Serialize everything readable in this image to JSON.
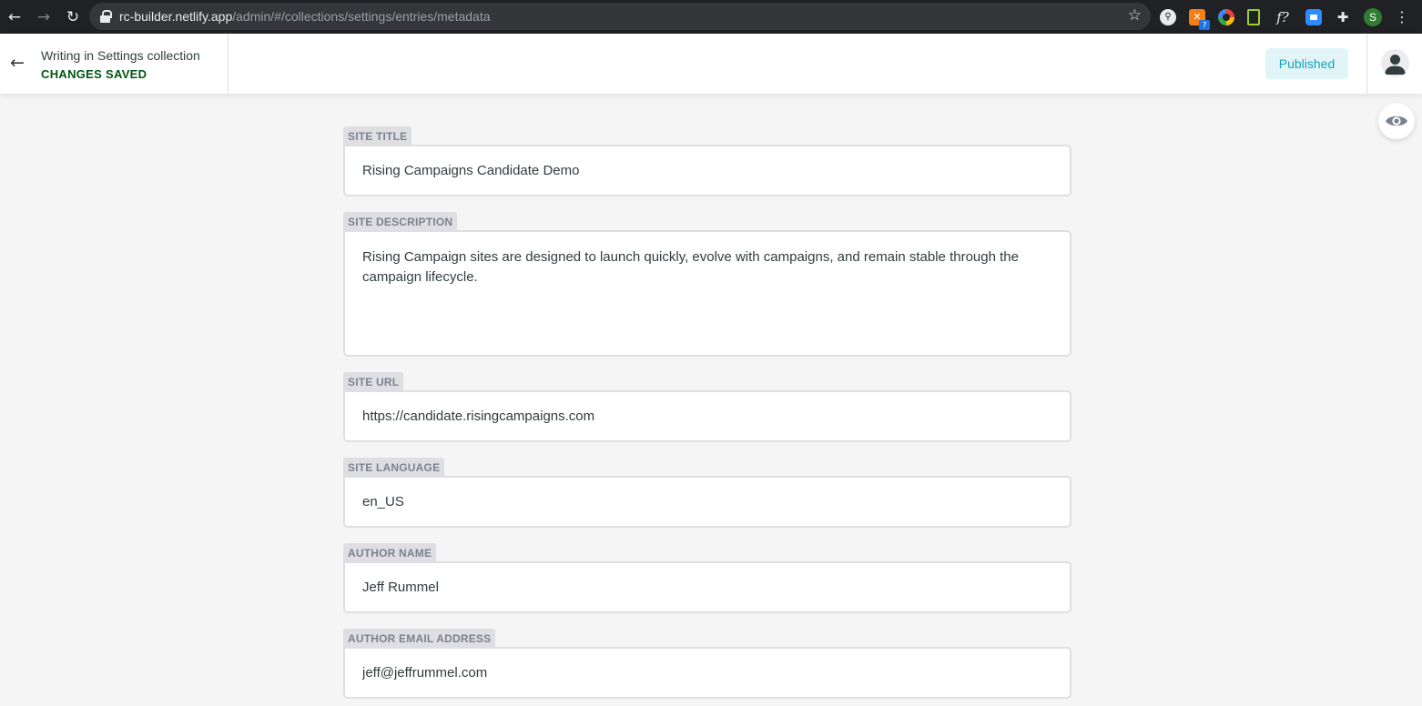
{
  "browser": {
    "url_host": "rc-builder.netlify.app",
    "url_path": "/admin/#/collections/settings/entries/metadata",
    "ext_badge": "7",
    "ext_formula": "f?",
    "profile_initial": "S"
  },
  "toolbar": {
    "collection_label": "Writing in Settings collection",
    "status_label": "CHANGES SAVED",
    "publish_status": "Published"
  },
  "fields": {
    "site_title": {
      "label": "SITE TITLE",
      "value": "Rising Campaigns Candidate Demo"
    },
    "site_description": {
      "label": "SITE DESCRIPTION",
      "value": "Rising Campaign sites are designed to launch quickly, evolve with campaigns, and remain stable through the campaign lifecycle."
    },
    "site_url": {
      "label": "SITE URL",
      "value": "https://candidate.risingcampaigns.com"
    },
    "site_language": {
      "label": "SITE LANGUAGE",
      "value": "en_US"
    },
    "author_name": {
      "label": "AUTHOR NAME",
      "value": "Jeff Rummel"
    },
    "author_email": {
      "label": "AUTHOR EMAIL ADDRESS",
      "value": "jeff@jeffrummel.com"
    }
  },
  "colors": {
    "saved_green": "#005614",
    "published_bg": "#e1f5f8",
    "published_text": "#17a2b8",
    "field_border": "#dfdfe3",
    "label_text": "#7a8291"
  }
}
